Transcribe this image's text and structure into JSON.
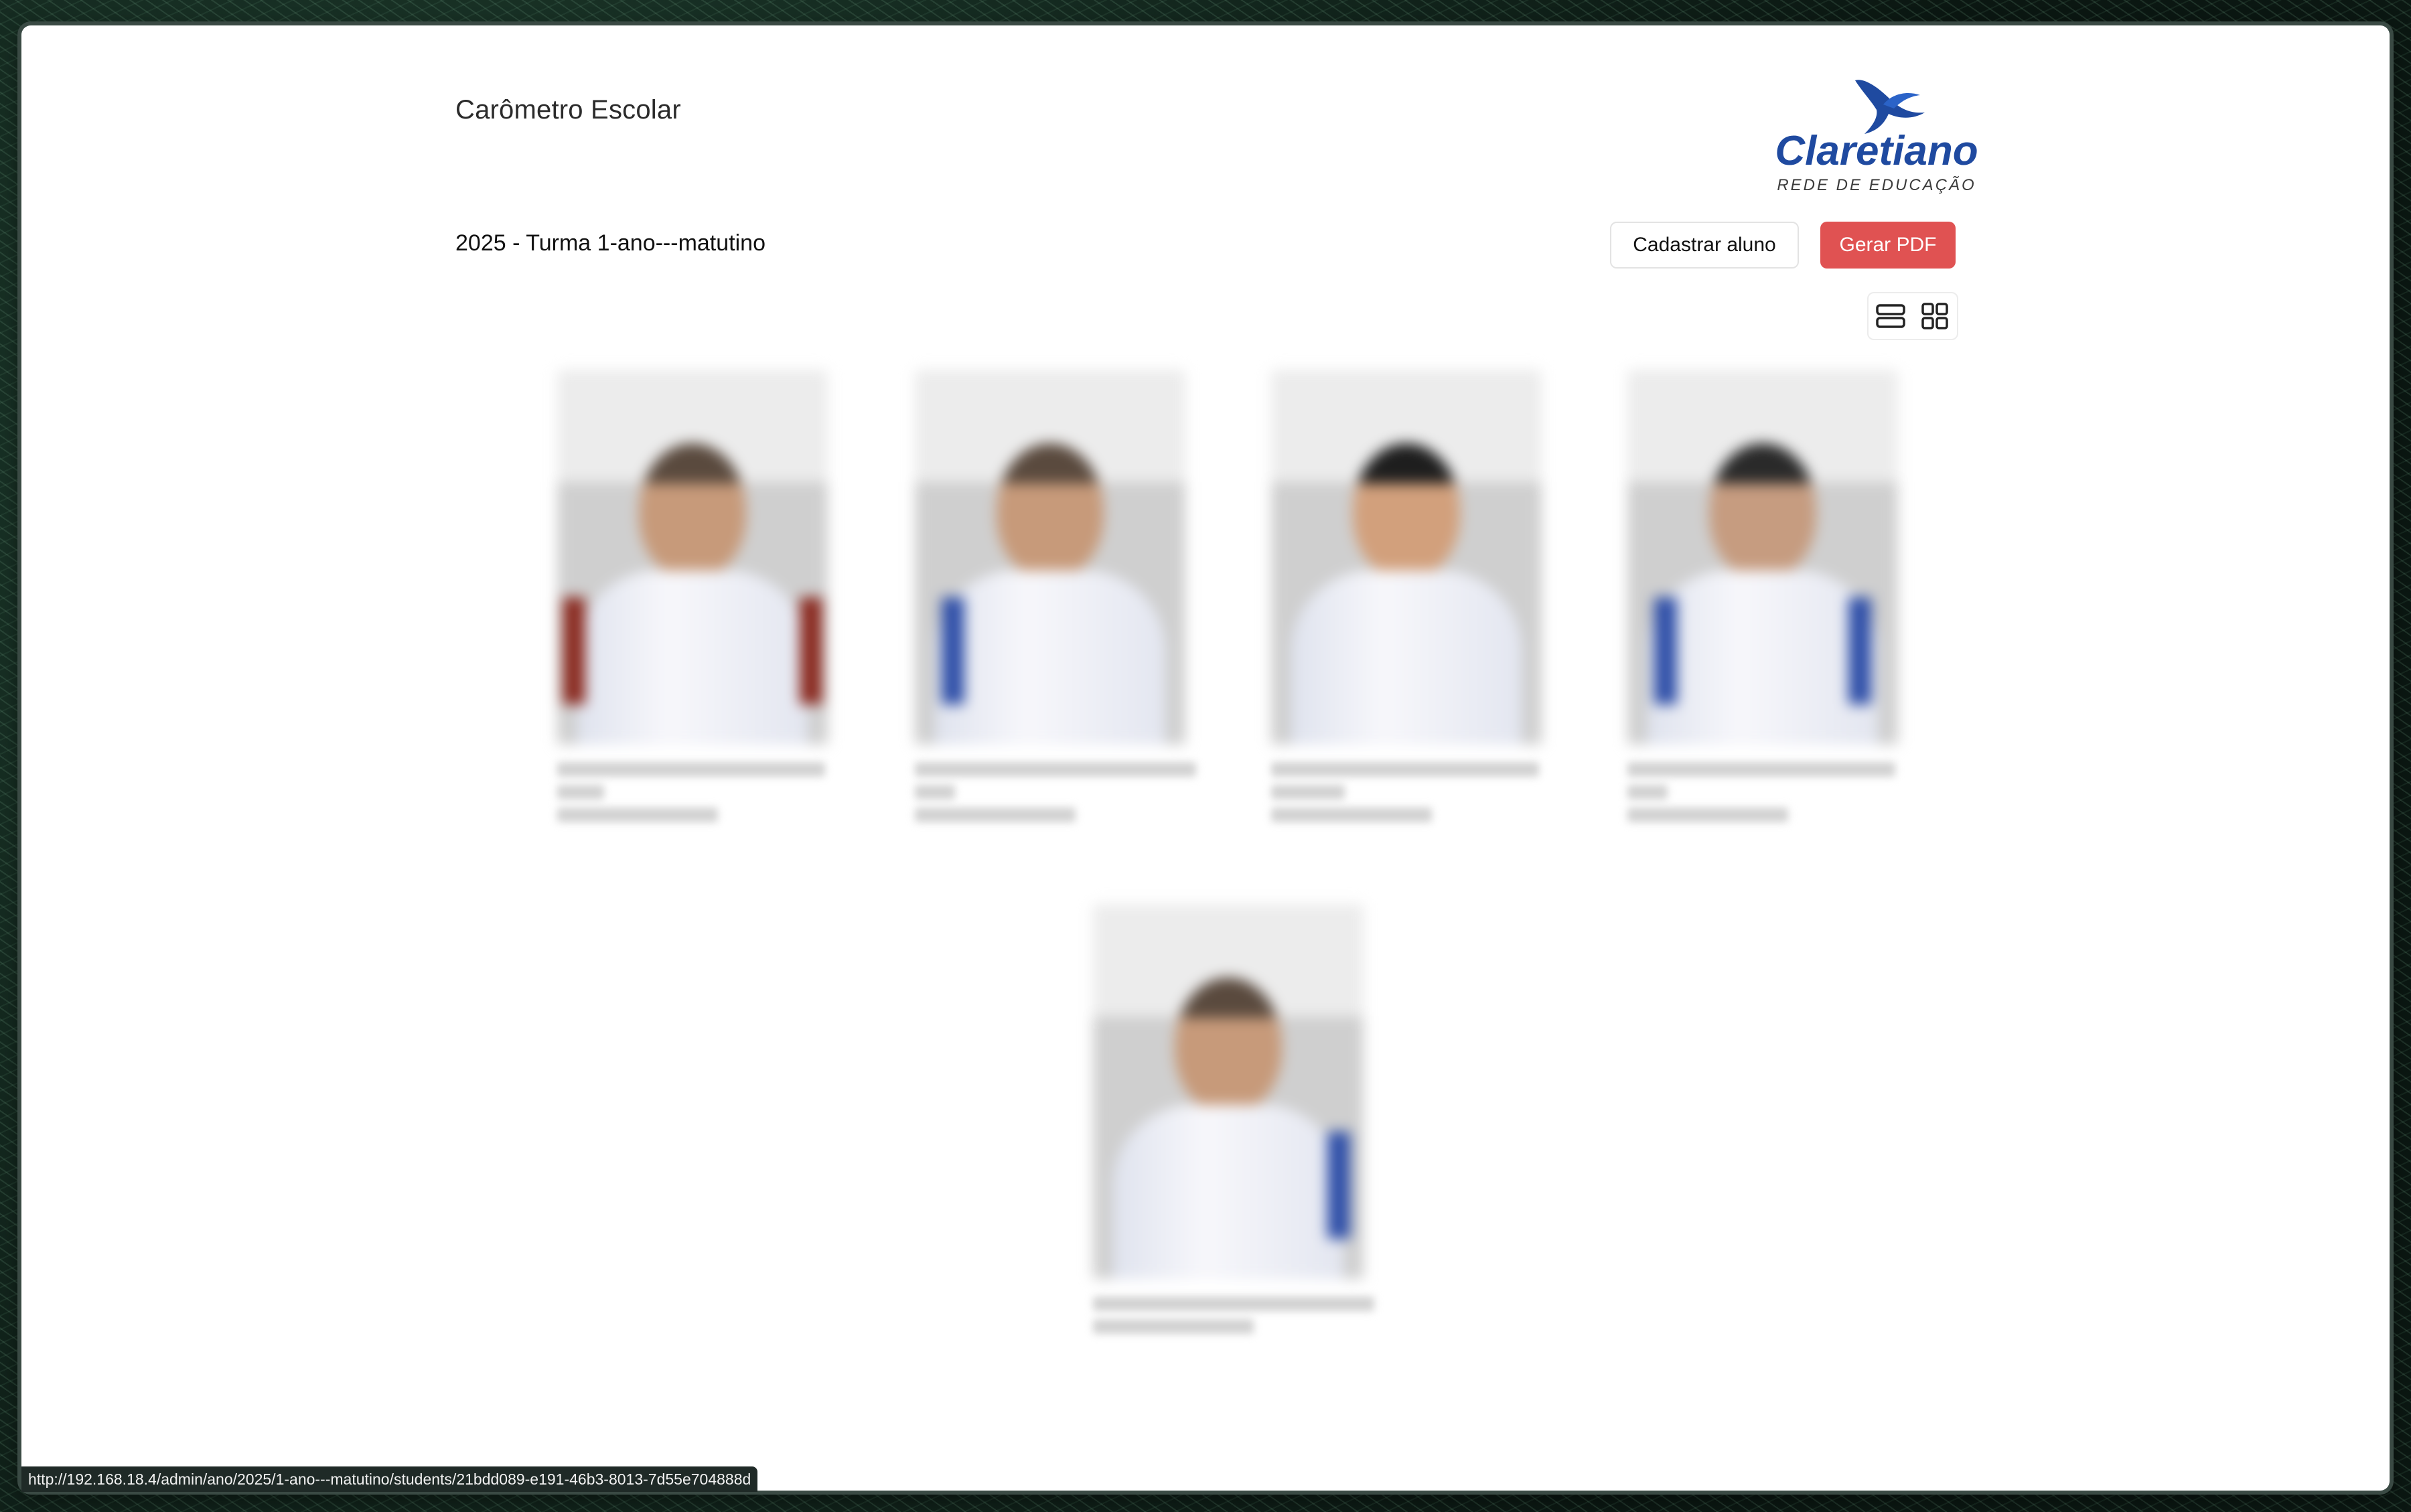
{
  "app": {
    "title": "Carômetro Escolar"
  },
  "logo": {
    "name": "Claretiano",
    "tagline": "REDE DE EDUCAÇÃO",
    "colors": {
      "brand": "#1f4aa0",
      "tagline": "#3c3c3c"
    }
  },
  "class_header": {
    "title": "2025 - Turma 1-ano---matutino"
  },
  "actions": {
    "register_label": "Cadastrar aluno",
    "pdf_label": "Gerar PDF",
    "primary_color": "#e05252"
  },
  "view_toggle": {
    "options": [
      {
        "icon": "list-view-icon"
      },
      {
        "icon": "grid-view-icon"
      }
    ]
  },
  "students": [
    {
      "photo": "blurred-student-photo-1",
      "caption": ""
    },
    {
      "photo": "blurred-student-photo-2",
      "caption": ""
    },
    {
      "photo": "blurred-student-photo-3",
      "caption": ""
    },
    {
      "photo": "blurred-student-photo-4",
      "caption": ""
    },
    {
      "photo": "blurred-student-photo-5",
      "caption": ""
    }
  ],
  "status_bar": {
    "url": "http://192.168.18.4/admin/ano/2025/1-ano---matutino/students/21bdd089-e191-46b3-8013-7d55e704888d"
  }
}
